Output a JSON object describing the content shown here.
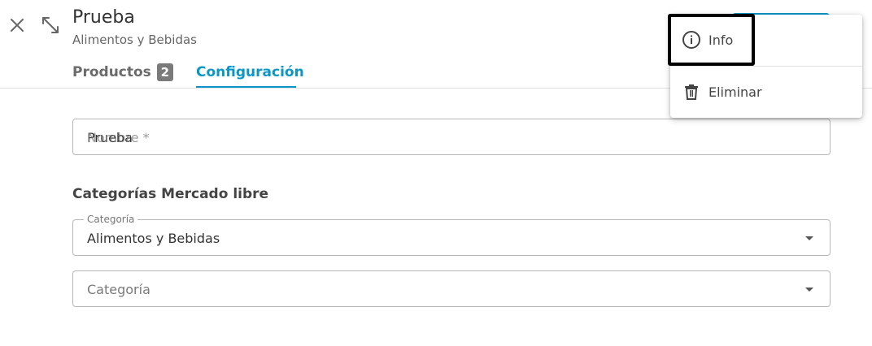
{
  "header": {
    "title": "Prueba",
    "subtitle": "Alimentos y Bebidas"
  },
  "tabs": [
    {
      "label": "Productos",
      "badge": "2"
    },
    {
      "label": "Configuración"
    }
  ],
  "form": {
    "name_value": "Prueba",
    "name_label": "Nombre *",
    "section_title": "Categorías Mercado libre",
    "category_label": "Categoría",
    "category_value": "Alimentos y Bebidas",
    "subcategory_placeholder": "Categoría"
  },
  "menu": {
    "items": [
      {
        "label": "Info",
        "icon": "info-icon"
      },
      {
        "label": "Eliminar",
        "icon": "trash-icon"
      }
    ]
  },
  "colors": {
    "accent": "#0a97c7",
    "badge": "#7a7a7a",
    "highlight": "#000000"
  }
}
